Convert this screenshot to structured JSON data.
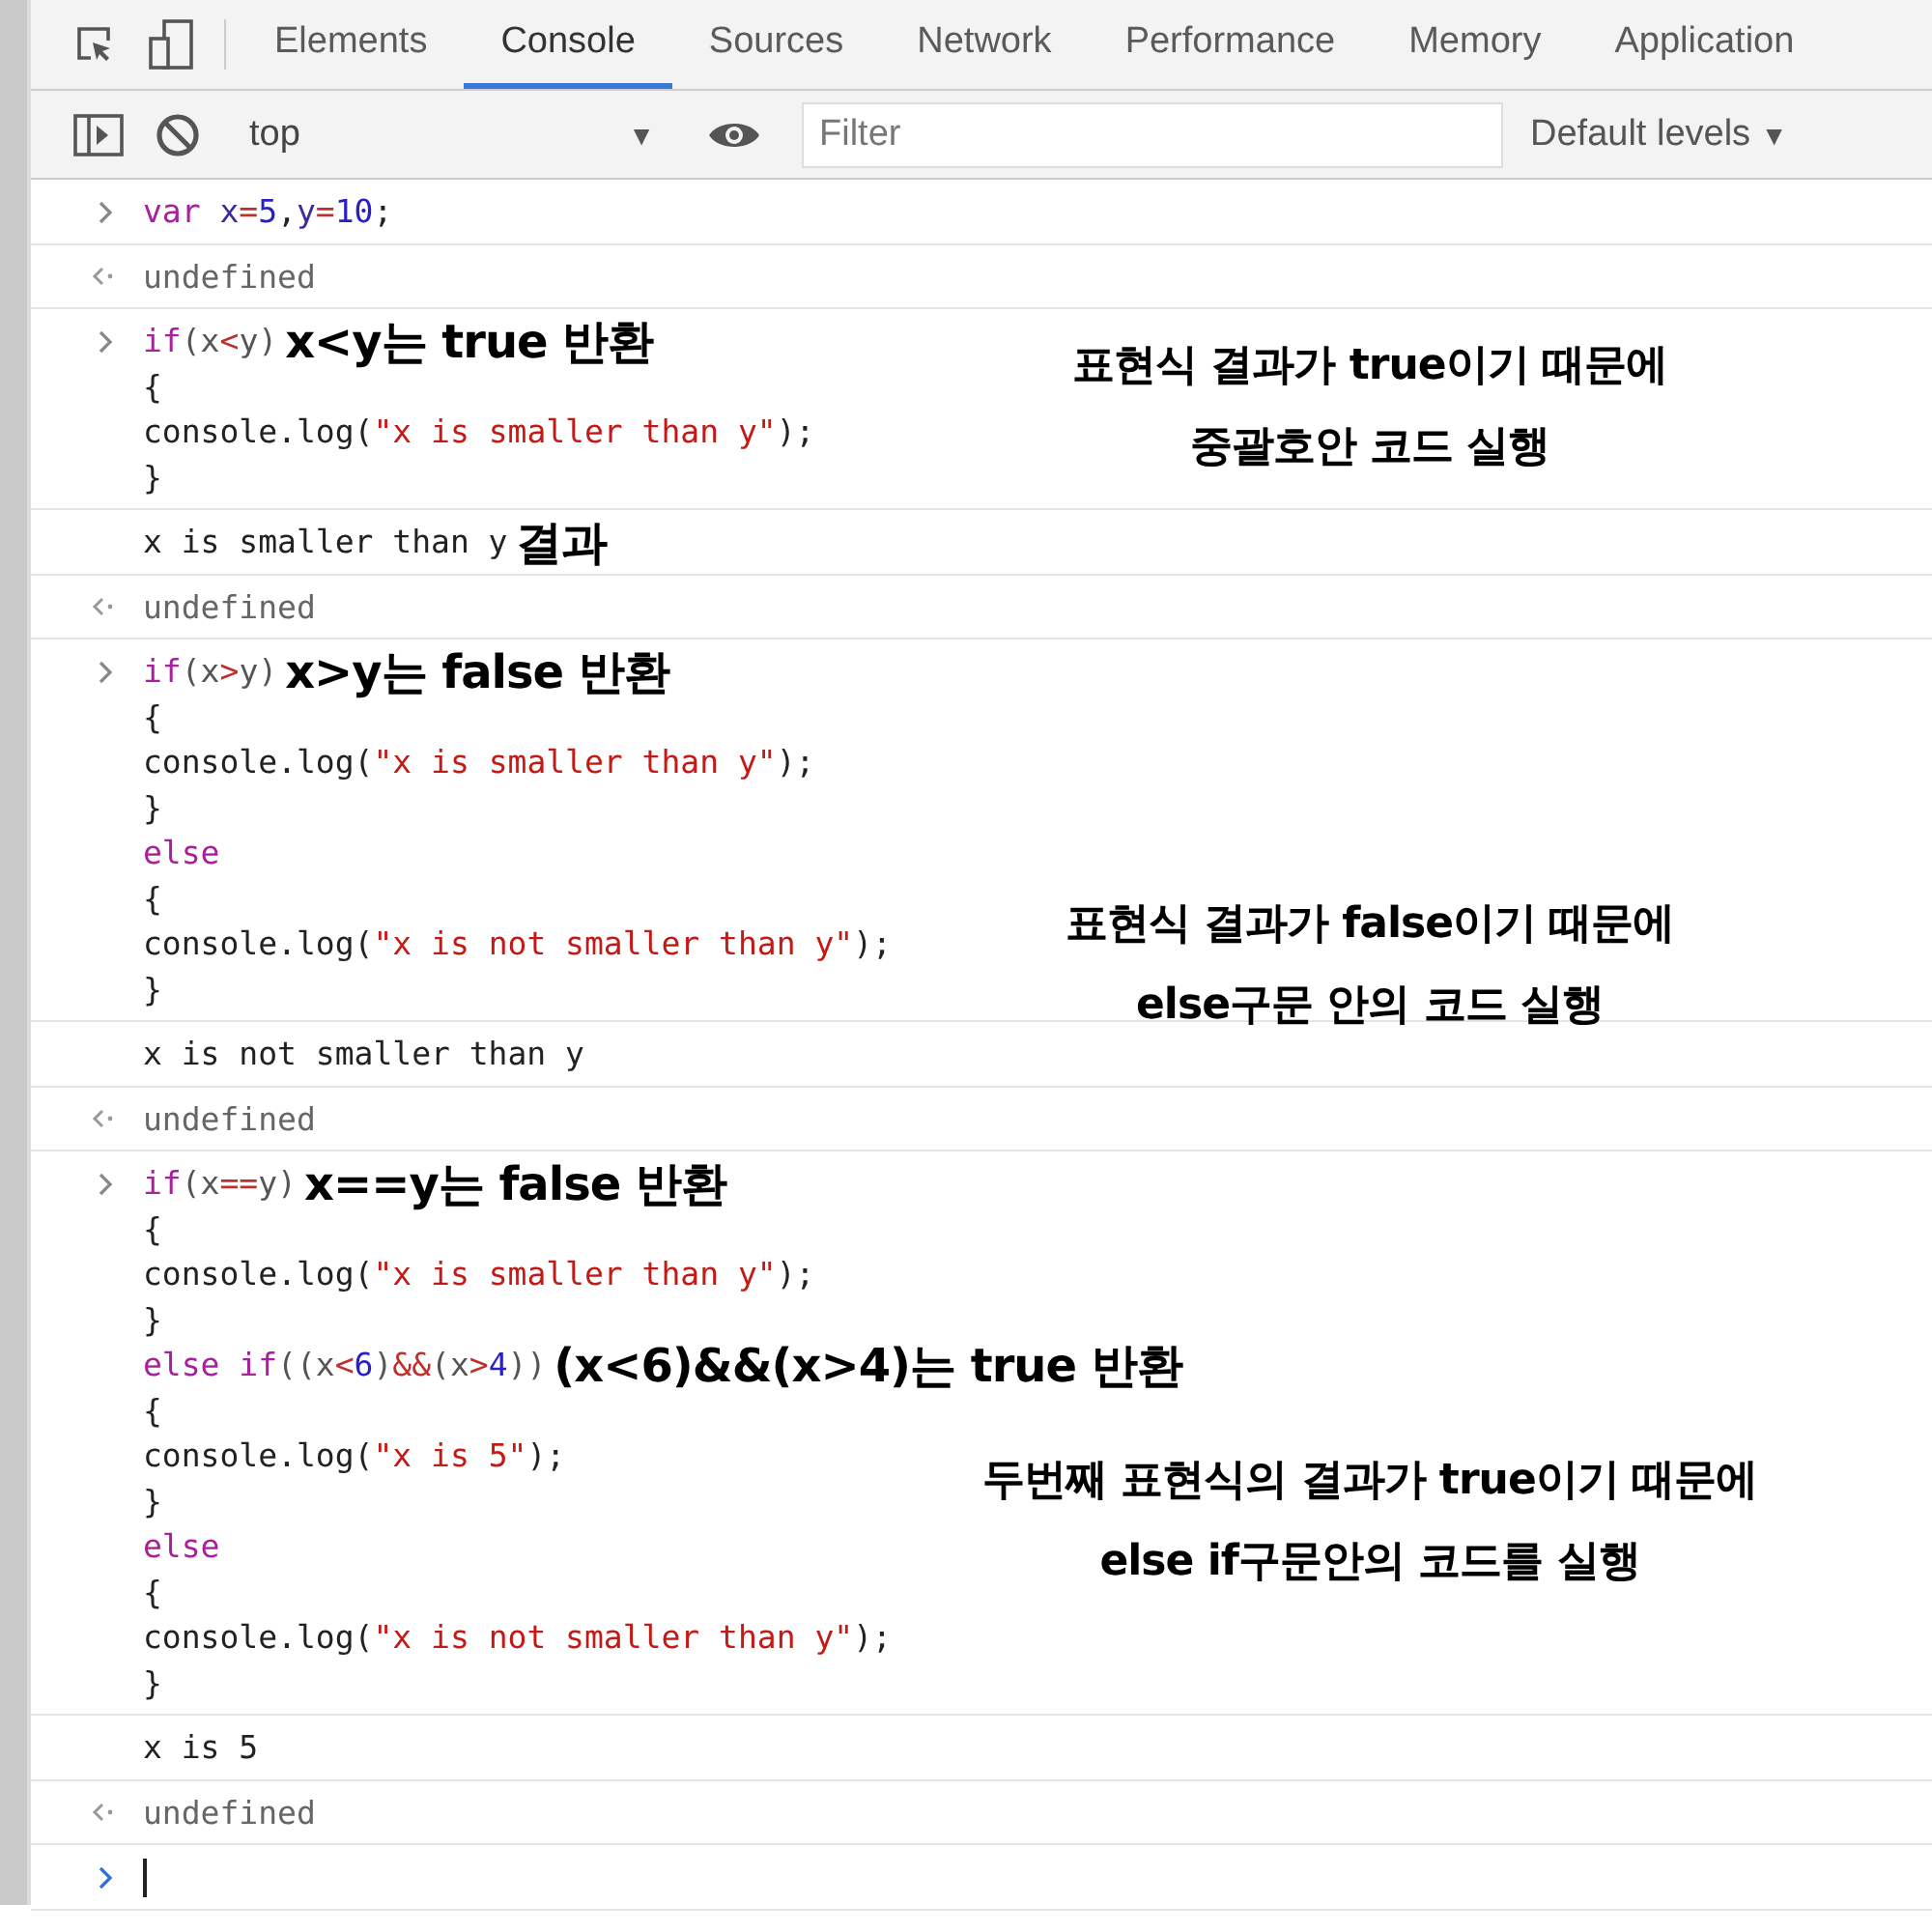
{
  "tabs": [
    {
      "label": "Elements",
      "selected": false
    },
    {
      "label": "Console",
      "selected": true
    },
    {
      "label": "Sources",
      "selected": false
    },
    {
      "label": "Network",
      "selected": false
    },
    {
      "label": "Performance",
      "selected": false
    },
    {
      "label": "Memory",
      "selected": false
    },
    {
      "label": "Application",
      "selected": false
    }
  ],
  "toolbar": {
    "context": "top",
    "context_caret": "▼",
    "filter": {
      "placeholder": "Filter"
    },
    "levels": "Default levels",
    "levels_caret": "▼"
  },
  "entries": [
    {
      "kind": "input",
      "lines": [
        {
          "tokens": [
            {
              "kind": "keyword",
              "text": "var",
              "spaced": true
            },
            {
              "kind": "variable",
              "text": "x"
            },
            {
              "kind": "operator",
              "text": "="
            },
            {
              "kind": "number",
              "text": "5"
            },
            {
              "kind": "plain",
              "text": ","
            },
            {
              "kind": "variable",
              "text": "y"
            },
            {
              "kind": "operator",
              "text": "="
            },
            {
              "kind": "number",
              "text": "10"
            },
            {
              "kind": "plain",
              "text": ";"
            }
          ]
        }
      ]
    },
    {
      "kind": "result",
      "lines": [
        {
          "tokens": [
            {
              "kind": "muted",
              "text": "undefined"
            }
          ]
        }
      ]
    },
    {
      "kind": "input",
      "lines": [
        {
          "tokens": [
            {
              "kind": "keyword",
              "text": "if"
            },
            {
              "kind": "punct",
              "text": "(x"
            },
            {
              "kind": "operator",
              "text": "<"
            },
            {
              "kind": "punct",
              "text": "y)"
            },
            {
              "kind": "note",
              "text": "x<y는 true 반환"
            }
          ],
          "callout": [
            "표현식 결과가 true이기 때문에",
            "중괄호안 코드 실행"
          ]
        },
        {
          "tokens": [
            {
              "kind": "plain",
              "text": "{"
            }
          ]
        },
        {
          "tokens": [
            {
              "kind": "plain",
              "text": "console.log("
            },
            {
              "kind": "string",
              "text": "\"x is smaller than y\""
            },
            {
              "kind": "plain",
              "text": ");"
            }
          ]
        },
        {
          "tokens": [
            {
              "kind": "plain",
              "text": "}"
            }
          ]
        }
      ]
    },
    {
      "kind": "log",
      "lines": [
        {
          "tokens": [
            {
              "kind": "plain",
              "text": "x is smaller than y"
            },
            {
              "kind": "note",
              "text": "결과"
            }
          ]
        }
      ]
    },
    {
      "kind": "result",
      "lines": [
        {
          "tokens": [
            {
              "kind": "muted",
              "text": "undefined"
            }
          ]
        }
      ]
    },
    {
      "kind": "input",
      "lines": [
        {
          "tokens": [
            {
              "kind": "keyword",
              "text": "if"
            },
            {
              "kind": "punct",
              "text": "(x"
            },
            {
              "kind": "operator",
              "text": ">"
            },
            {
              "kind": "punct",
              "text": "y)"
            },
            {
              "kind": "note",
              "text": "x>y는 false 반환"
            }
          ]
        },
        {
          "tokens": [
            {
              "kind": "plain",
              "text": "{"
            }
          ]
        },
        {
          "tokens": [
            {
              "kind": "plain",
              "text": "console.log("
            },
            {
              "kind": "string",
              "text": "\"x is smaller than y\""
            },
            {
              "kind": "plain",
              "text": ");"
            }
          ]
        },
        {
          "tokens": [
            {
              "kind": "plain",
              "text": "}"
            }
          ]
        },
        {
          "tokens": [
            {
              "kind": "keyword",
              "text": "else"
            }
          ]
        },
        {
          "tokens": [
            {
              "kind": "plain",
              "text": "{"
            }
          ],
          "callout": [
            "표현식 결과가 false이기 때문에",
            "else구문 안의 코드 실행"
          ]
        },
        {
          "tokens": [
            {
              "kind": "plain",
              "text": "console.log("
            },
            {
              "kind": "string",
              "text": "\"x is not smaller than y\""
            },
            {
              "kind": "plain",
              "text": ");"
            }
          ]
        },
        {
          "tokens": [
            {
              "kind": "plain",
              "text": "}"
            }
          ]
        }
      ]
    },
    {
      "kind": "log",
      "lines": [
        {
          "tokens": [
            {
              "kind": "plain",
              "text": "x is not smaller than y"
            }
          ]
        }
      ]
    },
    {
      "kind": "result",
      "lines": [
        {
          "tokens": [
            {
              "kind": "muted",
              "text": "undefined"
            }
          ]
        }
      ]
    },
    {
      "kind": "input",
      "lines": [
        {
          "tokens": [
            {
              "kind": "keyword",
              "text": "if"
            },
            {
              "kind": "punct",
              "text": "(x"
            },
            {
              "kind": "operator",
              "text": "=="
            },
            {
              "kind": "punct",
              "text": "y)"
            },
            {
              "kind": "note",
              "text": "x==y는 false 반환"
            }
          ]
        },
        {
          "tokens": [
            {
              "kind": "plain",
              "text": "{"
            }
          ]
        },
        {
          "tokens": [
            {
              "kind": "plain",
              "text": "console.log("
            },
            {
              "kind": "string",
              "text": "\"x is smaller than y\""
            },
            {
              "kind": "plain",
              "text": ");"
            }
          ]
        },
        {
          "tokens": [
            {
              "kind": "plain",
              "text": "}"
            }
          ]
        },
        {
          "tokens": [
            {
              "kind": "keyword",
              "text": "else if"
            },
            {
              "kind": "punct",
              "text": "((x"
            },
            {
              "kind": "operator",
              "text": "<"
            },
            {
              "kind": "number",
              "text": "6"
            },
            {
              "kind": "punct",
              "text": ")"
            },
            {
              "kind": "operator",
              "text": "&&"
            },
            {
              "kind": "punct",
              "text": "(x"
            },
            {
              "kind": "operator",
              "text": ">"
            },
            {
              "kind": "number",
              "text": "4"
            },
            {
              "kind": "punct",
              "text": "))"
            },
            {
              "kind": "note",
              "text": "(x<6)&&(x>4)는 true 반환"
            }
          ]
        },
        {
          "tokens": [
            {
              "kind": "plain",
              "text": "{"
            }
          ]
        },
        {
          "tokens": [
            {
              "kind": "plain",
              "text": "console.log("
            },
            {
              "kind": "string",
              "text": "\"x is 5\""
            },
            {
              "kind": "plain",
              "text": ");"
            }
          ],
          "callout": [
            "두번째 표현식의 결과가 true이기 때문에",
            "else if구문안의 코드를 실행"
          ]
        },
        {
          "tokens": [
            {
              "kind": "plain",
              "text": "}"
            }
          ]
        },
        {
          "tokens": [
            {
              "kind": "keyword",
              "text": "else"
            }
          ]
        },
        {
          "tokens": [
            {
              "kind": "plain",
              "text": "{"
            }
          ]
        },
        {
          "tokens": [
            {
              "kind": "plain",
              "text": "console.log("
            },
            {
              "kind": "string",
              "text": "\"x is not smaller than y\""
            },
            {
              "kind": "plain",
              "text": ");"
            }
          ]
        },
        {
          "tokens": [
            {
              "kind": "plain",
              "text": "}"
            }
          ]
        }
      ]
    },
    {
      "kind": "log",
      "lines": [
        {
          "tokens": [
            {
              "kind": "plain",
              "text": "x is 5"
            }
          ]
        }
      ]
    },
    {
      "kind": "result",
      "lines": [
        {
          "tokens": [
            {
              "kind": "muted",
              "text": "undefined"
            }
          ]
        }
      ]
    },
    {
      "kind": "prompt"
    }
  ]
}
